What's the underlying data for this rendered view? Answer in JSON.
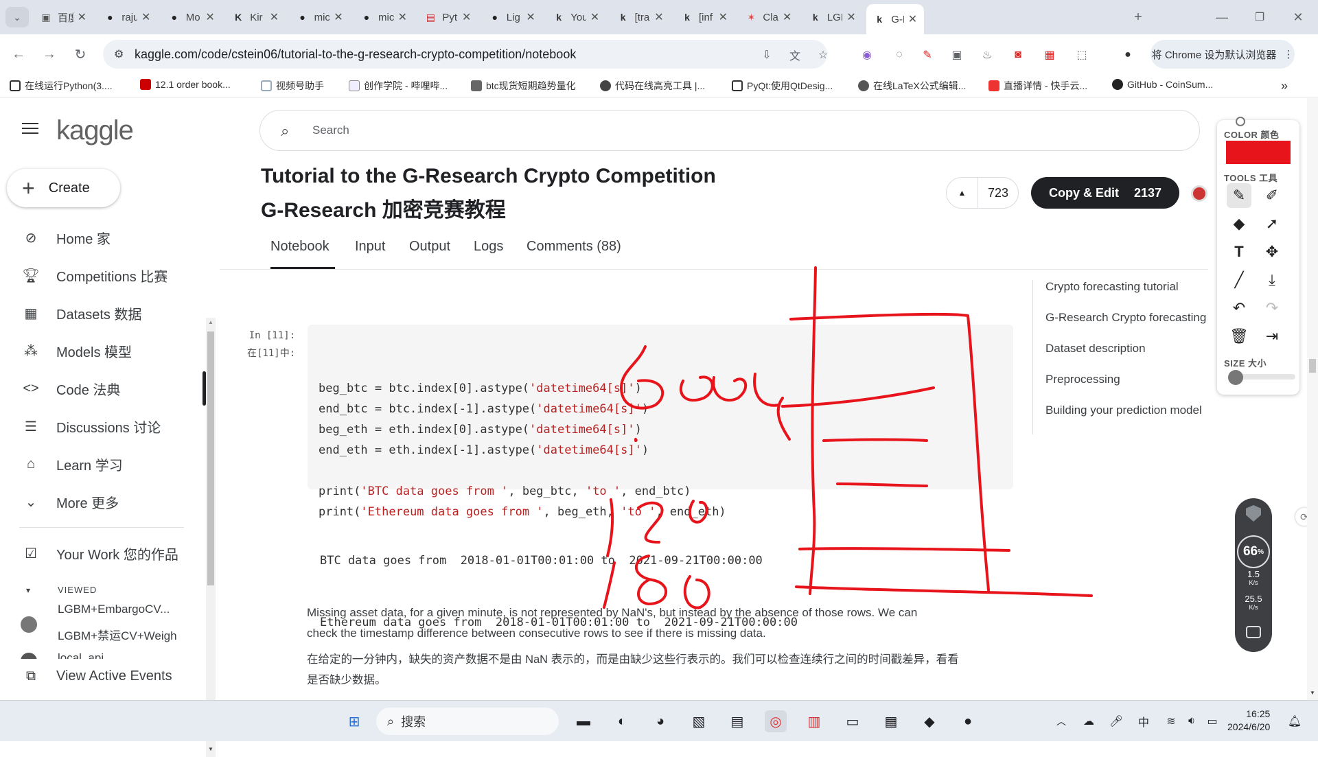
{
  "browser": {
    "tabs": [
      {
        "title": "百度",
        "icon": "baidu-icon"
      },
      {
        "title": "raju",
        "icon": "github-icon"
      },
      {
        "title": "Mo",
        "icon": "github-icon"
      },
      {
        "title": "Kir",
        "icon": "k-icon"
      },
      {
        "title": "mic",
        "icon": "github-icon"
      },
      {
        "title": "mic",
        "icon": "github-icon"
      },
      {
        "title": "Pyt",
        "icon": "doc-icon"
      },
      {
        "title": "Lig",
        "icon": "github-icon"
      },
      {
        "title": "You",
        "icon": "kaggle-icon"
      },
      {
        "title": "[tra",
        "icon": "kaggle-icon"
      },
      {
        "title": "[inf",
        "icon": "kaggle-icon"
      },
      {
        "title": "Cla",
        "icon": "star-icon"
      },
      {
        "title": "LGE",
        "icon": "kaggle-icon"
      },
      {
        "title": "G-R",
        "icon": "kaggle-icon"
      }
    ],
    "url": "kaggle.com/code/cstein06/tutorial-to-the-g-research-crypto-competition/notebook",
    "default_browser_btn": "将 Chrome 设为默认浏览器",
    "bookmarks": [
      "在线运行Python(3....",
      "12.1 order book...",
      "视频号助手",
      "创作学院 - 哔哩哔...",
      "btc现货短期趋势量化",
      "代码在线高亮工具 |...",
      "PyQt:使用QtDesig...",
      "在线LaTeX公式编辑...",
      "直播详情 - 快手云...",
      "GitHub - CoinSum..."
    ]
  },
  "sidebar": {
    "logo": "kaggle",
    "create": "Create",
    "items": [
      {
        "label": "Home 家",
        "icon": "compass-icon"
      },
      {
        "label": "Competitions 比赛",
        "icon": "trophy-icon"
      },
      {
        "label": "Datasets 数据",
        "icon": "table-icon"
      },
      {
        "label": "Models 模型",
        "icon": "models-icon"
      },
      {
        "label": "Code 法典",
        "icon": "code-icon"
      },
      {
        "label": "Discussions 讨论",
        "icon": "discussion-icon"
      },
      {
        "label": "Learn 学习",
        "icon": "school-icon"
      },
      {
        "label": "More 更多",
        "icon": "chevron-down-icon"
      }
    ],
    "your_work": "Your Work 您的作品",
    "viewed_label": "VIEWED",
    "viewed": [
      "LGBM+EmbargoCV...",
      "LGBM+禁运CV+Weigh",
      "local_api"
    ],
    "view_active_events": "View Active Events"
  },
  "search": {
    "placeholder": "Search"
  },
  "notebook": {
    "title_en": "Tutorial to the G-Research Crypto Competition",
    "title_cn": "G-Research 加密竞赛教程",
    "votes": "723",
    "copy_edit": "Copy & Edit",
    "copy_count": "2137",
    "tabs": [
      "Notebook",
      "Input",
      "Output",
      "Logs",
      "Comments (88)"
    ],
    "prompt_en": "In [11]:",
    "prompt_cn": "在[11]中:",
    "code": [
      "beg_btc = btc.index[0].astype('datetime64[s]')",
      "end_btc = btc.index[-1].astype('datetime64[s]')",
      "beg_eth = eth.index[0].astype('datetime64[s]')",
      "end_eth = eth.index[-1].astype('datetime64[s]')",
      "",
      "print('BTC data goes from ', beg_btc, 'to ', end_btc)",
      "print('Ethereum data goes from ', beg_eth, 'to ', end_eth)"
    ],
    "output": [
      "BTC data goes from  2018-01-01T00:01:00 to  2021-09-21T00:00:00",
      "Ethereum data goes from  2018-01-01T00:01:00 to  2021-09-21T00:00:00"
    ],
    "para_en_1": "Missing asset data, for a given minute, is not represented by NaN's, but instead by the absence of those rows. We can",
    "para_en_2": "check the timestamp difference between consecutive rows to see if there is missing data.",
    "para_cn_1": "在给定的一分钟内，缺失的资产数据不是由 NaN 表示的，而是由缺少这些行表示的。我们可以检查连续行之间的时间戳差异，看看",
    "para_cn_2": "是否缺少数据。"
  },
  "toc": [
    "Crypto forecasting tutorial",
    "G-Research Crypto forecasting",
    "Dataset description",
    "Preprocessing",
    "Building your prediction model"
  ],
  "draw_panel": {
    "color_label": "COLOR 颜色",
    "color": "#e8141b",
    "tools_label": "TOOLS 工具",
    "size_label": "SIZE 大小"
  },
  "speed_widget": {
    "percent": "66",
    "up": "1.5",
    "up_unit": "K/s",
    "down": "25.5",
    "down_unit": "K/s"
  },
  "taskbar": {
    "search": "搜索",
    "ime": "中",
    "time": "16:25",
    "date": "2024/6/20"
  }
}
